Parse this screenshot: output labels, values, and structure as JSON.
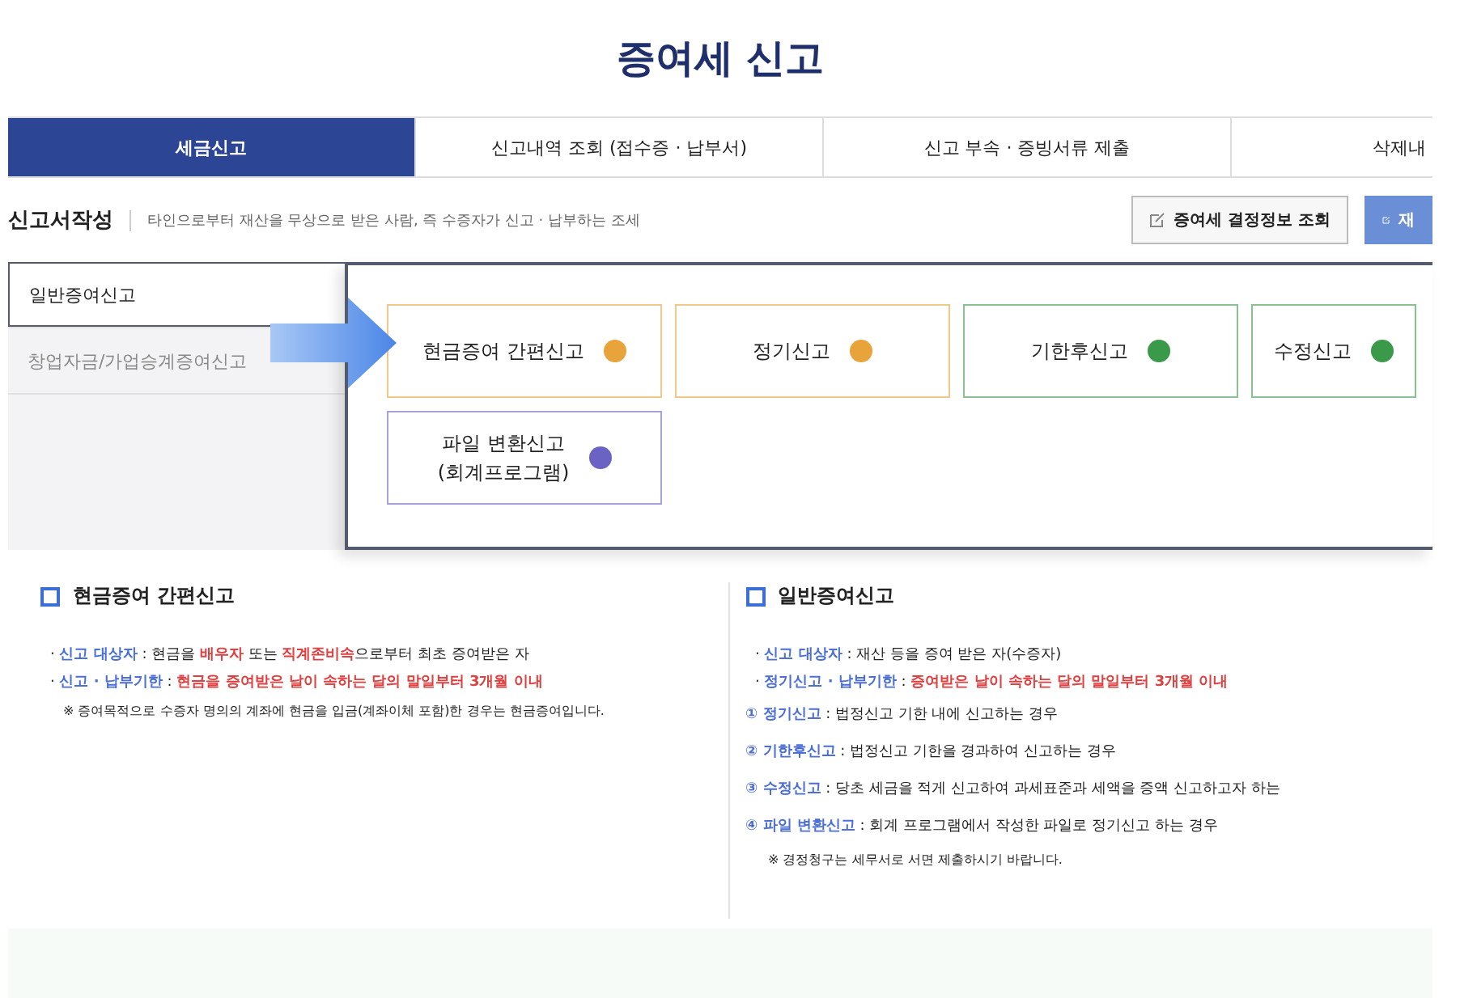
{
  "title": "증여세 신고",
  "tabs": [
    {
      "label": "세금신고",
      "selected": true
    },
    {
      "label": "신고내역 조회 (접수증 · 납부서)",
      "selected": false
    },
    {
      "label": "신고 부속 · 증빙서류 제출",
      "selected": false
    },
    {
      "label": "삭제내",
      "selected": false
    }
  ],
  "section": {
    "title": "신고서작성",
    "description": "타인으로부터 재산을 무상으로 받은 사람, 즉 수증자가 신고 · 납부하는 조세",
    "buttons": [
      {
        "label": "증여세 결정정보 조회",
        "kind": "outline"
      },
      {
        "label": "재",
        "kind": "primary"
      }
    ]
  },
  "sidebar": {
    "items": [
      {
        "label": "일반증여신고",
        "selected": true
      },
      {
        "label": "창업자금/가업승계증여신고",
        "selected": false
      }
    ]
  },
  "cards": [
    {
      "label": "현금증여 간편신고",
      "color": "#e8a33a"
    },
    {
      "label": "정기신고",
      "color": "#e8a33a"
    },
    {
      "label": "기한후신고",
      "color": "#3a9a4a"
    },
    {
      "label": "수정신고",
      "color": "#3a9a4a"
    },
    {
      "label": "파일 변환신고\n(회계프로그램)",
      "color": "#6a63c4"
    }
  ],
  "info": [
    {
      "title": "현금증여 간편신고",
      "lines": [
        {
          "kind": "bullet",
          "parts": [
            {
              "kind": "plain",
              "text": "· "
            },
            {
              "kind": "label",
              "text": "신고 대상자"
            },
            {
              "kind": "plain",
              "text": " : 현금을 "
            },
            {
              "kind": "highlight",
              "text": "배우자"
            },
            {
              "kind": "plain",
              "text": " 또는 "
            },
            {
              "kind": "highlight",
              "text": "직계존비속"
            },
            {
              "kind": "plain",
              "text": "으로부터 최초 증여받은 자"
            }
          ]
        },
        {
          "kind": "bullet",
          "parts": [
            {
              "kind": "plain",
              "text": "· "
            },
            {
              "kind": "label",
              "text": "신고 · 납부기한"
            },
            {
              "kind": "plain",
              "text": " : "
            },
            {
              "kind": "highlight",
              "text": "현금을 증여받은 날이 속하는 달의 말일부터 3개월 이내"
            }
          ]
        },
        {
          "kind": "note",
          "parts": [
            {
              "kind": "plain",
              "text": "※ 증여목적으로 수증자 명의의 계좌에 현금을 입금(계좌이체 포함)한 경우는 현금증여입니다."
            }
          ]
        }
      ]
    },
    {
      "title": "일반증여신고",
      "lines": [
        {
          "kind": "bullet",
          "parts": [
            {
              "kind": "plain",
              "text": "· "
            },
            {
              "kind": "label",
              "text": "신고 대상자"
            },
            {
              "kind": "plain",
              "text": " : 재산 등을 증여 받은 자(수증자)"
            }
          ]
        },
        {
          "kind": "bullet",
          "parts": [
            {
              "kind": "plain",
              "text": "· "
            },
            {
              "kind": "label",
              "text": "정기신고 · 납부기한"
            },
            {
              "kind": "plain",
              "text": " : "
            },
            {
              "kind": "highlight",
              "text": "증여받은 날이 속하는 달의 말일부터 3개월 이내"
            }
          ]
        },
        {
          "kind": "numbered",
          "parts": [
            {
              "kind": "label",
              "text": "① 정기신고"
            },
            {
              "kind": "plain",
              "text": " : 법정신고 기한 내에 신고하는 경우"
            }
          ]
        },
        {
          "kind": "numbered",
          "parts": [
            {
              "kind": "label",
              "text": "② 기한후신고"
            },
            {
              "kind": "plain",
              "text": " : 법정신고 기한을 경과하여 신고하는 경우"
            }
          ]
        },
        {
          "kind": "numbered",
          "parts": [
            {
              "kind": "label",
              "text": "③ 수정신고"
            },
            {
              "kind": "plain",
              "text": " : 당초 세금을 적게 신고하여 과세표준과 세액을 증액 신고하고자 하는"
            }
          ]
        },
        {
          "kind": "numbered",
          "parts": [
            {
              "kind": "label",
              "text": "④ 파일 변환신고"
            },
            {
              "kind": "plain",
              "text": " : 회계 프로그램에서 작성한 파일로 정기신고 하는 경우"
            }
          ]
        },
        {
          "kind": "note",
          "parts": [
            {
              "kind": "plain",
              "text": "※ 경정청구는 세무서로 서면 제출하시기 바랍니다."
            }
          ]
        }
      ]
    }
  ]
}
